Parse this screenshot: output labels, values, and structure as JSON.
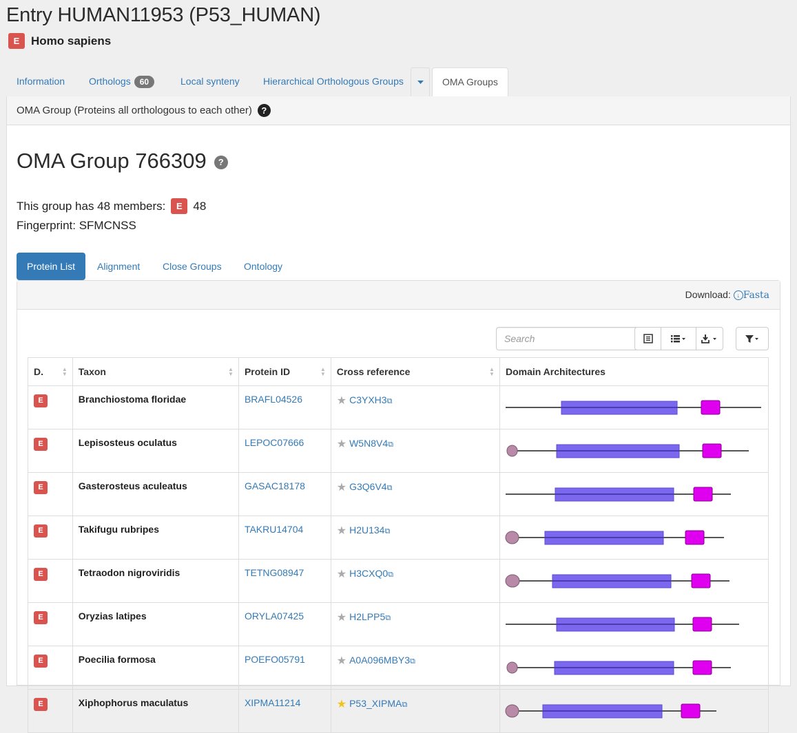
{
  "entry": {
    "title": "Entry HUMAN11953 (P53_HUMAN)",
    "kingdom": "E",
    "species": "Homo sapiens"
  },
  "main_tabs": [
    {
      "label": "Information"
    },
    {
      "label": "Orthologs",
      "count": "60"
    },
    {
      "label": "Local synteny"
    },
    {
      "label": "Hierarchical Orthologous Groups"
    },
    {
      "label": "OMA Groups",
      "active": true
    }
  ],
  "panel": {
    "heading": "OMA Group (Proteins all orthologous to each other)",
    "help": "?"
  },
  "group": {
    "title": "OMA Group 766309",
    "help": "?",
    "members_label": "This group has 48 members:",
    "members_kingdom": "E",
    "members_count": "48",
    "fingerprint": "Fingerprint: SFMCNSS"
  },
  "sub_tabs": [
    {
      "label": "Protein List",
      "active": true
    },
    {
      "label": "Alignment"
    },
    {
      "label": "Close Groups"
    },
    {
      "label": "Ontology"
    }
  ],
  "download": {
    "label": "Download:",
    "link": "Fasta"
  },
  "search": {
    "placeholder": "Search"
  },
  "toolbar_icons": [
    "list-view-icon",
    "columns-icon",
    "export-icon",
    "filter-icon"
  ],
  "table": {
    "headers": [
      "D.",
      "Taxon",
      "Protein ID",
      "Cross reference",
      "Domain Architectures"
    ],
    "rows": [
      {
        "d": "E",
        "taxon": "Branchiostoma floridae",
        "protein_id": "BRAFL04526",
        "xref": "C3YXH3",
        "gold": false
      },
      {
        "d": "E",
        "taxon": "Lepisosteus oculatus",
        "protein_id": "LEPOC07666",
        "xref": "W5N8V4",
        "gold": false
      },
      {
        "d": "E",
        "taxon": "Gasterosteus aculeatus",
        "protein_id": "GASAC18178",
        "xref": "G3Q6V4",
        "gold": false
      },
      {
        "d": "E",
        "taxon": "Takifugu rubripes",
        "protein_id": "TAKRU14704",
        "xref": "H2U134",
        "gold": false
      },
      {
        "d": "E",
        "taxon": "Tetraodon nigroviridis",
        "protein_id": "TETNG08947",
        "xref": "H3CXQ0",
        "gold": false
      },
      {
        "d": "E",
        "taxon": "Oryzias latipes",
        "protein_id": "ORYLA07425",
        "xref": "H2LPP5",
        "gold": false
      },
      {
        "d": "E",
        "taxon": "Poecilia formosa",
        "protein_id": "POEFO05791",
        "xref": "A0A096MBY3",
        "gold": false
      },
      {
        "d": "E",
        "taxon": "Xiphophorus maculatus",
        "protein_id": "XIPMA11214",
        "xref": "P53_XIPMA",
        "gold": true
      }
    ]
  },
  "colors": {
    "link": "#337ab7",
    "badge": "#d9534f",
    "domain_main": "#7b68ee",
    "domain_tail": "#e000f0",
    "domain_head": "#b88aa8"
  }
}
